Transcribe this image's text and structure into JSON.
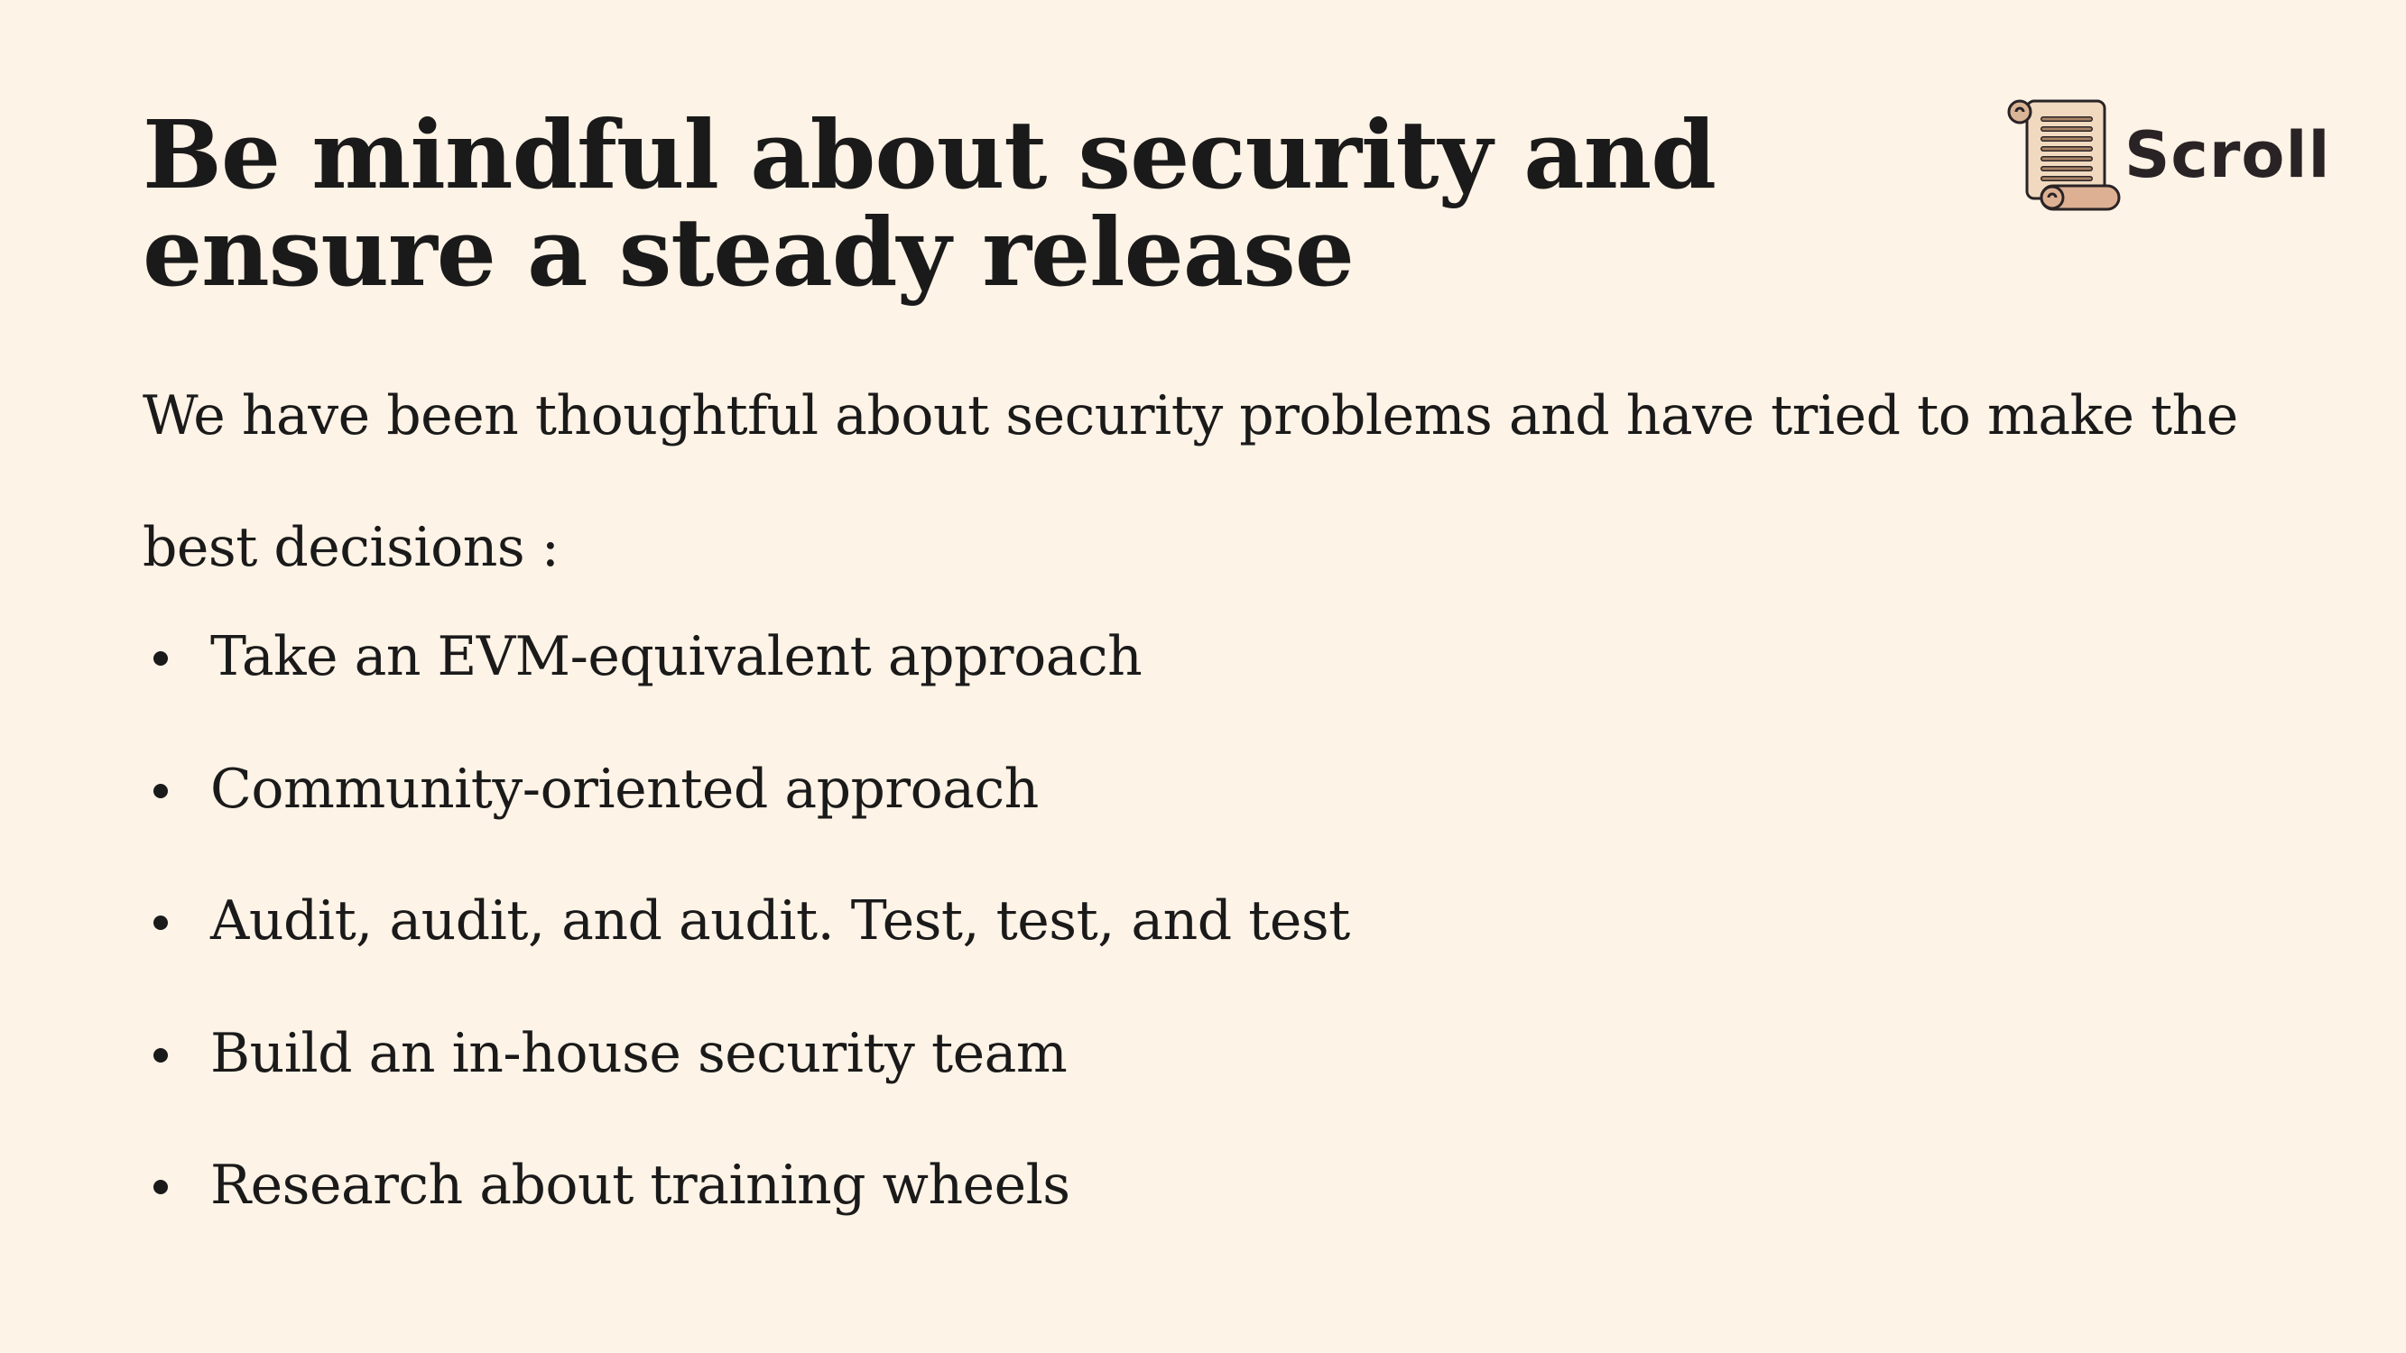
{
  "title": "Be mindful about security and ensure a steady release",
  "intro": "We have been thoughtful about security problems and have tried to make the best decisions :",
  "bullets": [
    "Take an EVM-equivalent approach",
    "Community-oriented approach",
    "Audit, audit, and audit. Test, test, and test",
    "Build an in-house security team",
    "Research about training wheels"
  ],
  "logo": {
    "text": "Scroll",
    "icon": "scroll-icon"
  }
}
